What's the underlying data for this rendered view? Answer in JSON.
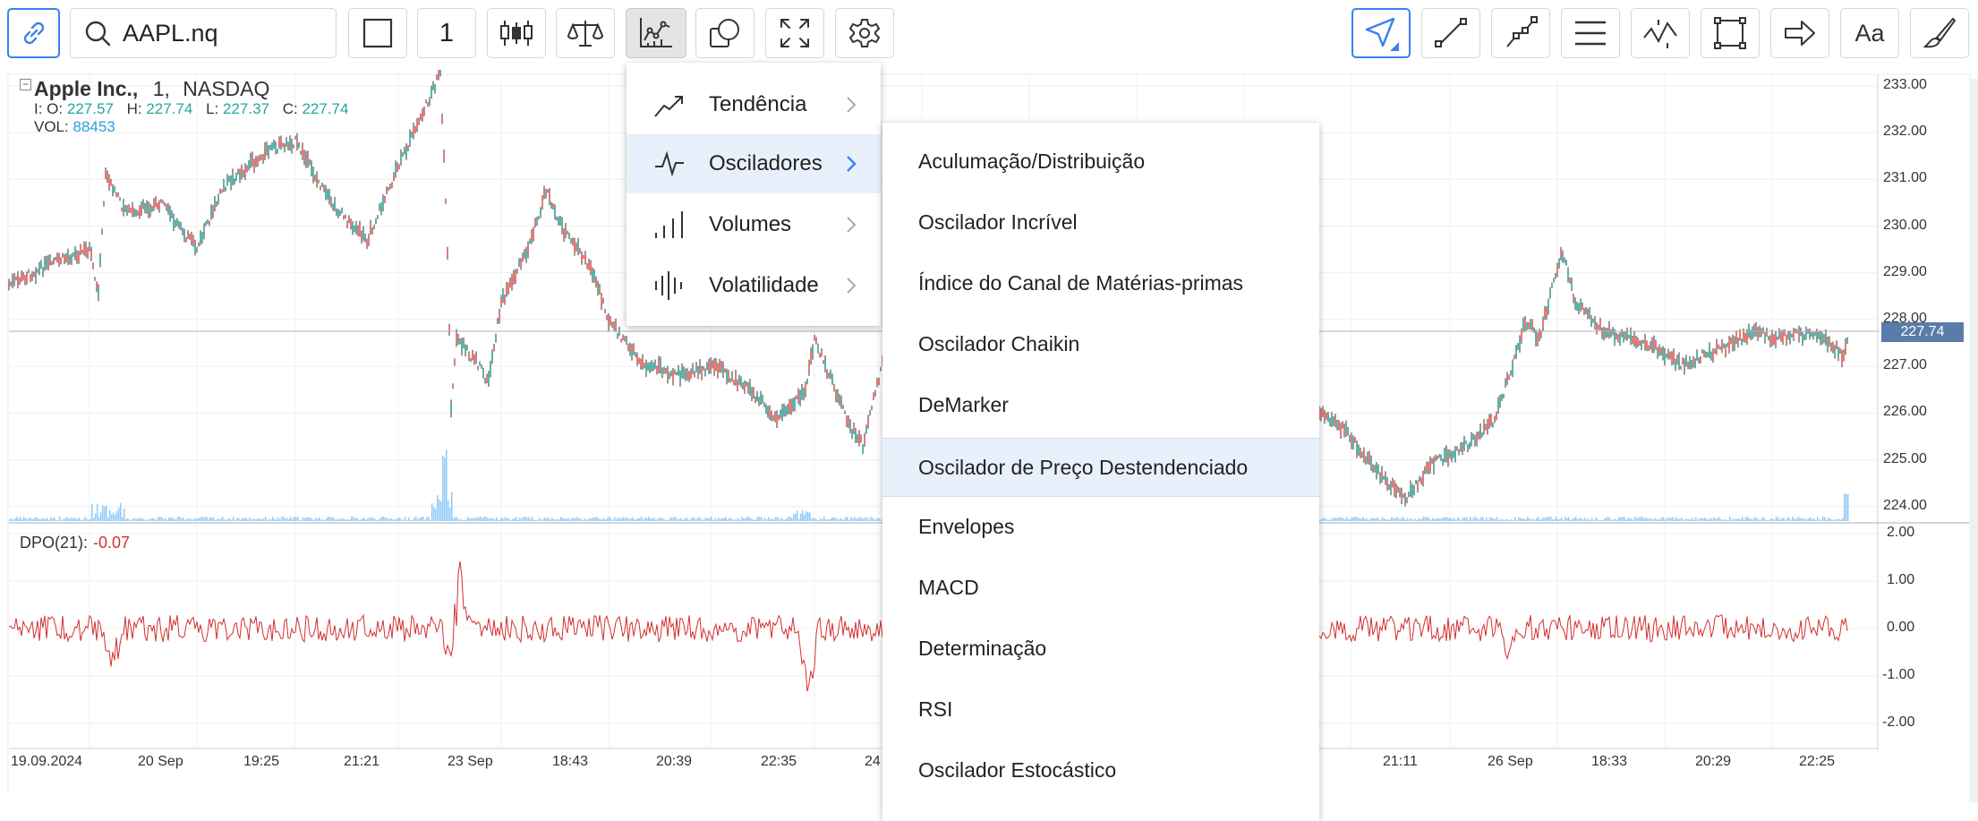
{
  "toolbar": {
    "symbol_value": "AAPL.nq",
    "interval_value": "1",
    "text_tool_label": "Aa"
  },
  "chart": {
    "legend": {
      "name": "Apple Inc.,",
      "interval": "1,",
      "exchange": "NASDAQ",
      "o_label": "I: O:",
      "o_value": "227.57",
      "h_label": "H:",
      "h_value": "227.74",
      "l_label": "L:",
      "l_value": "227.37",
      "c_label": "C:",
      "c_value": "227.74",
      "vol_label": "VOL:",
      "vol_value": "88453"
    },
    "indicator": {
      "label": "DPO(21):",
      "value": "-0.07"
    },
    "last_price_tag": "227.74",
    "price_axis": [
      "233.00",
      "232.00",
      "231.00",
      "230.00",
      "229.00",
      "228.00",
      "227.00",
      "226.00",
      "225.00",
      "224.00"
    ],
    "dpo_axis": [
      "2.00",
      "1.00",
      "0.00",
      "-1.00",
      "-2.00"
    ],
    "time_axis": [
      "19.09.2024",
      "20 Sep",
      "19:25",
      "21:21",
      "23 Sep",
      "18:43",
      "20:39",
      "22:35",
      "24",
      "21:11",
      "26 Sep",
      "18:33",
      "20:29",
      "22:25"
    ],
    "colors": {
      "up": "#26a69a",
      "down": "#ef5350",
      "volume": "#90caf9",
      "dpo": "#d32f2f",
      "accent": "#3d7ff0"
    }
  },
  "menu": {
    "categories": [
      {
        "label": "Tendência",
        "icon": "trend-icon"
      },
      {
        "label": "Osciladores",
        "icon": "oscillator-icon",
        "selected": true
      },
      {
        "label": "Volumes",
        "icon": "volume-bars-icon"
      },
      {
        "label": "Volatilidade",
        "icon": "volatility-icon"
      }
    ],
    "oscillators": [
      "Aculumação/Distribuição",
      "Oscilador Incrível",
      "Índice do Canal de Matérias-primas",
      "Oscilador Chaikin",
      "DeMarker",
      "Oscilador de Preço Destendenciado",
      "Envelopes",
      "MACD",
      "Determinação",
      "RSI",
      "Oscilador Estocástico"
    ],
    "highlighted_index": 5
  }
}
